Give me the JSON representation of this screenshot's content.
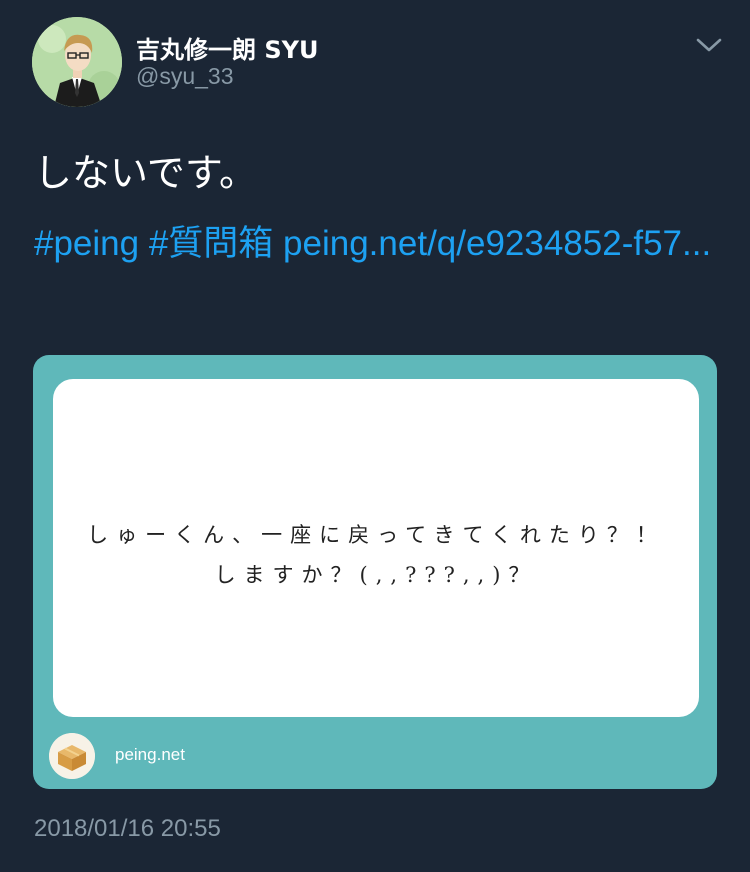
{
  "author": {
    "display_name": "吉丸修一朗 SYU",
    "handle": "@syu_33",
    "avatar_icon": "user-avatar"
  },
  "menu": {
    "icon": "chevron-down-icon"
  },
  "tweet": {
    "text": "しないです。",
    "hashtag_1": "#peing",
    "hashtag_2": "#質問箱",
    "link": "peing.net/q/e9234852-f57..."
  },
  "card": {
    "question": "しゅーくん、一座に戻ってきてくれたり？！しますか？(,,???,,)？",
    "site_name": "peing.net",
    "site_icon": "box-icon",
    "background_color": "#5fb8ba"
  },
  "timestamp": "2018/01/16 20:55",
  "colors": {
    "background": "#1b2635",
    "link": "#1da1f2",
    "secondary_text": "#8899a6"
  }
}
